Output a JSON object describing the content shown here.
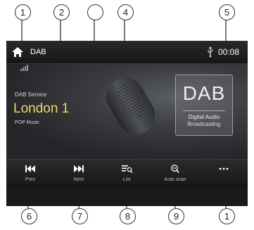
{
  "status": {
    "title": "DAB",
    "time": "00:08"
  },
  "main": {
    "service_label": "DAB Service",
    "station_name": "London 1",
    "genre": "POP Music",
    "badge": {
      "logo": "DAB",
      "line1": "Digital Audio",
      "line2": "Broadcasting"
    }
  },
  "controls": [
    {
      "label": "Prev",
      "icon": "prev-icon"
    },
    {
      "label": "Next",
      "icon": "next-icon"
    },
    {
      "label": "List",
      "icon": "list-icon"
    },
    {
      "label": "Auto scan",
      "icon": "zoom-out-icon"
    },
    {
      "label": "",
      "icon": "more-icon"
    }
  ],
  "callouts": {
    "c1": "1",
    "c2": "2",
    "c3": "",
    "c4": "4",
    "c5": "5",
    "c6": "6",
    "c7": "7",
    "c8": "8",
    "c9": "9",
    "c10": "1"
  },
  "colors": {
    "station_text": "#f1d36b",
    "background": "#1c1c1e"
  }
}
